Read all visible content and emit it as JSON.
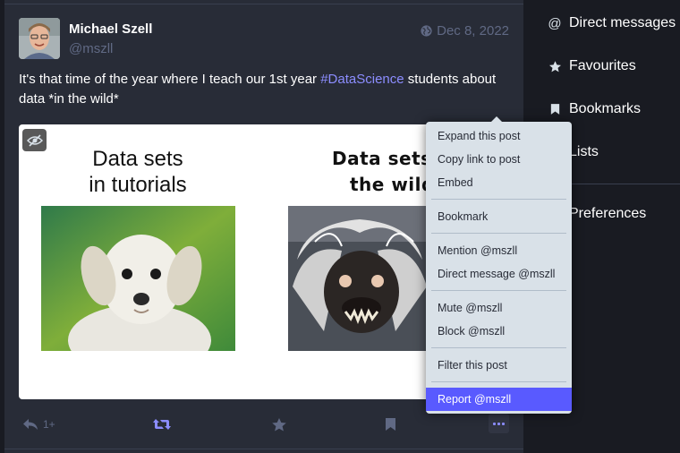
{
  "post": {
    "display_name": "Michael Szell",
    "acct": "@mszll",
    "date": "Dec 8, 2022",
    "text_before": "It's that time of the year where I teach our 1st year ",
    "hashtag": "#DataScience",
    "text_after": " students about data *in the wild*",
    "media": {
      "left_title_line1": "Data sets",
      "left_title_line2": "in tutorials",
      "right_title_line1": "Data sets i",
      "right_title_line2": "the wild"
    },
    "reply_count": "1+"
  },
  "sidebar": {
    "items": [
      {
        "label": "Direct messages",
        "icon": "at-icon"
      },
      {
        "label": "Favourites",
        "icon": "star-icon"
      },
      {
        "label": "Bookmarks",
        "icon": "bookmark-icon"
      },
      {
        "label": "Lists",
        "icon": "list-icon"
      },
      {
        "label": "Preferences",
        "icon": "gear-icon"
      }
    ]
  },
  "dropdown": {
    "expand": "Expand this post",
    "copy_link": "Copy link to post",
    "embed": "Embed",
    "bookmark": "Bookmark",
    "mention": "Mention @mszll",
    "direct_message": "Direct message @mszll",
    "mute": "Mute @mszll",
    "block": "Block @mszll",
    "filter": "Filter this post",
    "report": "Report @mszll"
  },
  "colors": {
    "accent": "#8c8dff",
    "highlight": "#595aff",
    "background": "#191b22",
    "panel": "#282c37"
  }
}
